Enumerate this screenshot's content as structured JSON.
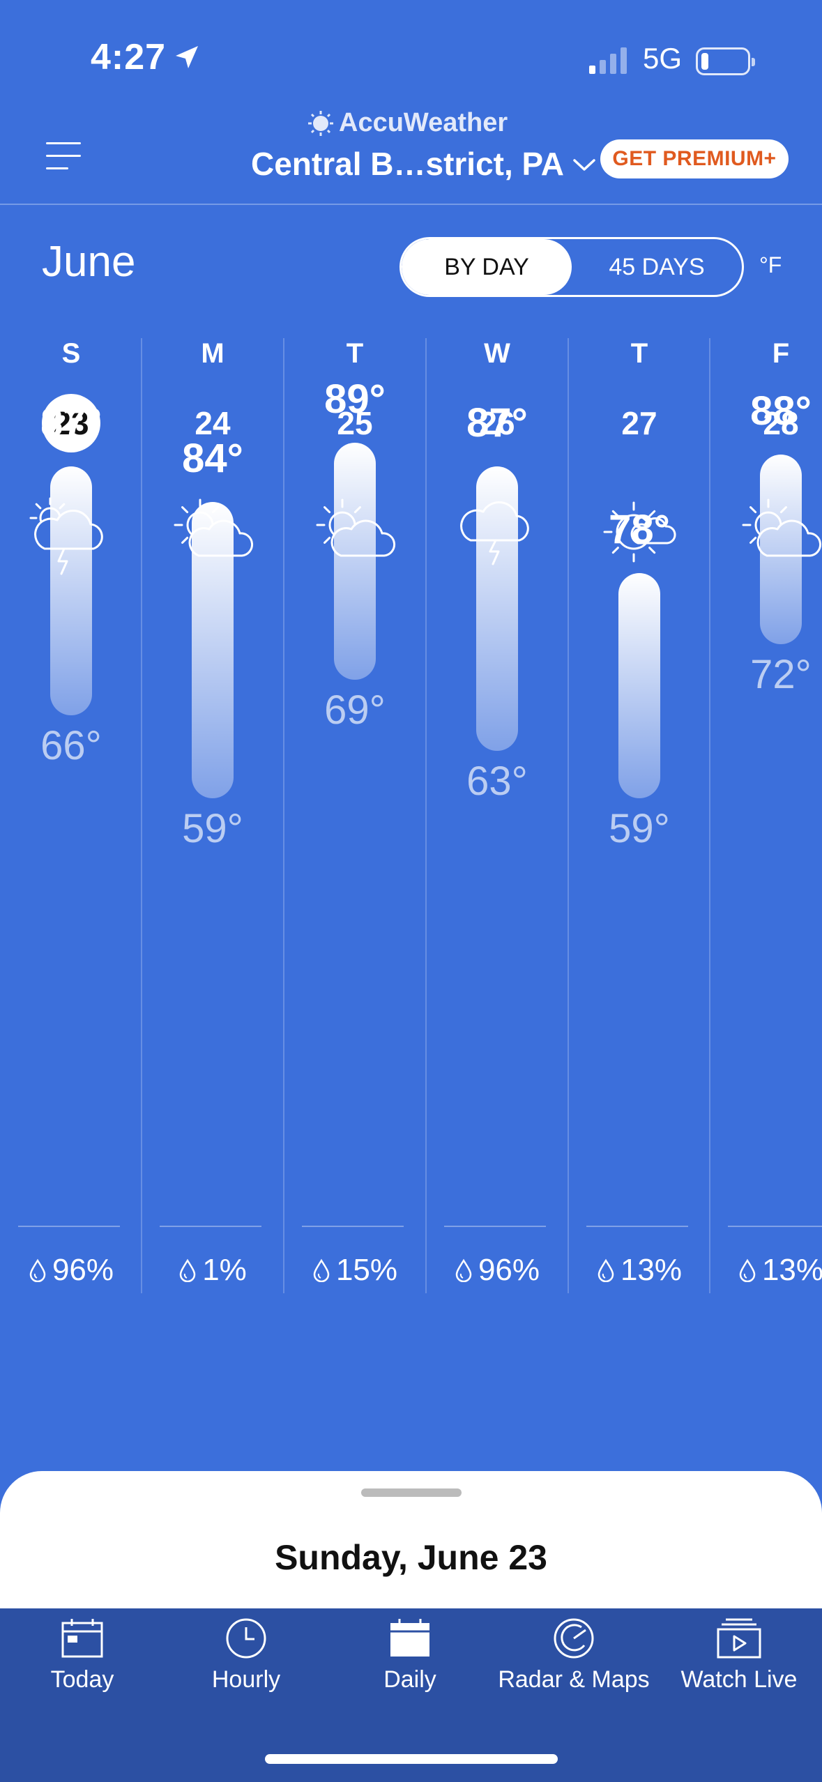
{
  "status_bar": {
    "time": "4:27",
    "network": "5G"
  },
  "header": {
    "brand": "AccuWeather",
    "location": "Central B…strict, PA",
    "premium_button": "GET PREMIUM+"
  },
  "controls": {
    "month": "June",
    "toggle_by_day": "BY DAY",
    "toggle_45_days": "45 DAYS",
    "unit": "°F"
  },
  "days": [
    {
      "dow": "S",
      "date": "23",
      "selected": true,
      "icon": "thunderstorm-sun-icon",
      "high": "87°",
      "low": "66°",
      "precip": "96%"
    },
    {
      "dow": "M",
      "date": "24",
      "selected": false,
      "icon": "partly-sunny-icon",
      "high": "84°",
      "low": "59°",
      "precip": "1%"
    },
    {
      "dow": "T",
      "date": "25",
      "selected": false,
      "icon": "partly-sunny-icon",
      "high": "89°",
      "low": "69°",
      "precip": "15%"
    },
    {
      "dow": "W",
      "date": "26",
      "selected": false,
      "icon": "thunderstorm-icon",
      "high": "87°",
      "low": "63°",
      "precip": "96%"
    },
    {
      "dow": "T",
      "date": "27",
      "selected": false,
      "icon": "mostly-sunny-icon",
      "high": "78°",
      "low": "59°",
      "precip": "13%"
    },
    {
      "dow": "F",
      "date": "28",
      "selected": false,
      "icon": "partly-sunny-icon",
      "high": "88°",
      "low": "72°",
      "precip": "13%"
    }
  ],
  "sheet": {
    "title": "Sunday, June 23"
  },
  "tabs": [
    {
      "label": "Today",
      "icon": "calendar-icon"
    },
    {
      "label": "Hourly",
      "icon": "clock-icon"
    },
    {
      "label": "Daily",
      "icon": "calendar-filled-icon"
    },
    {
      "label": "Radar & Maps",
      "icon": "radar-icon"
    },
    {
      "label": "Watch Live",
      "icon": "tv-play-icon"
    }
  ],
  "colors": {
    "background": "#3c6fdb",
    "tabbar": "#2c50a3",
    "premium_text": "#e05a1f"
  }
}
